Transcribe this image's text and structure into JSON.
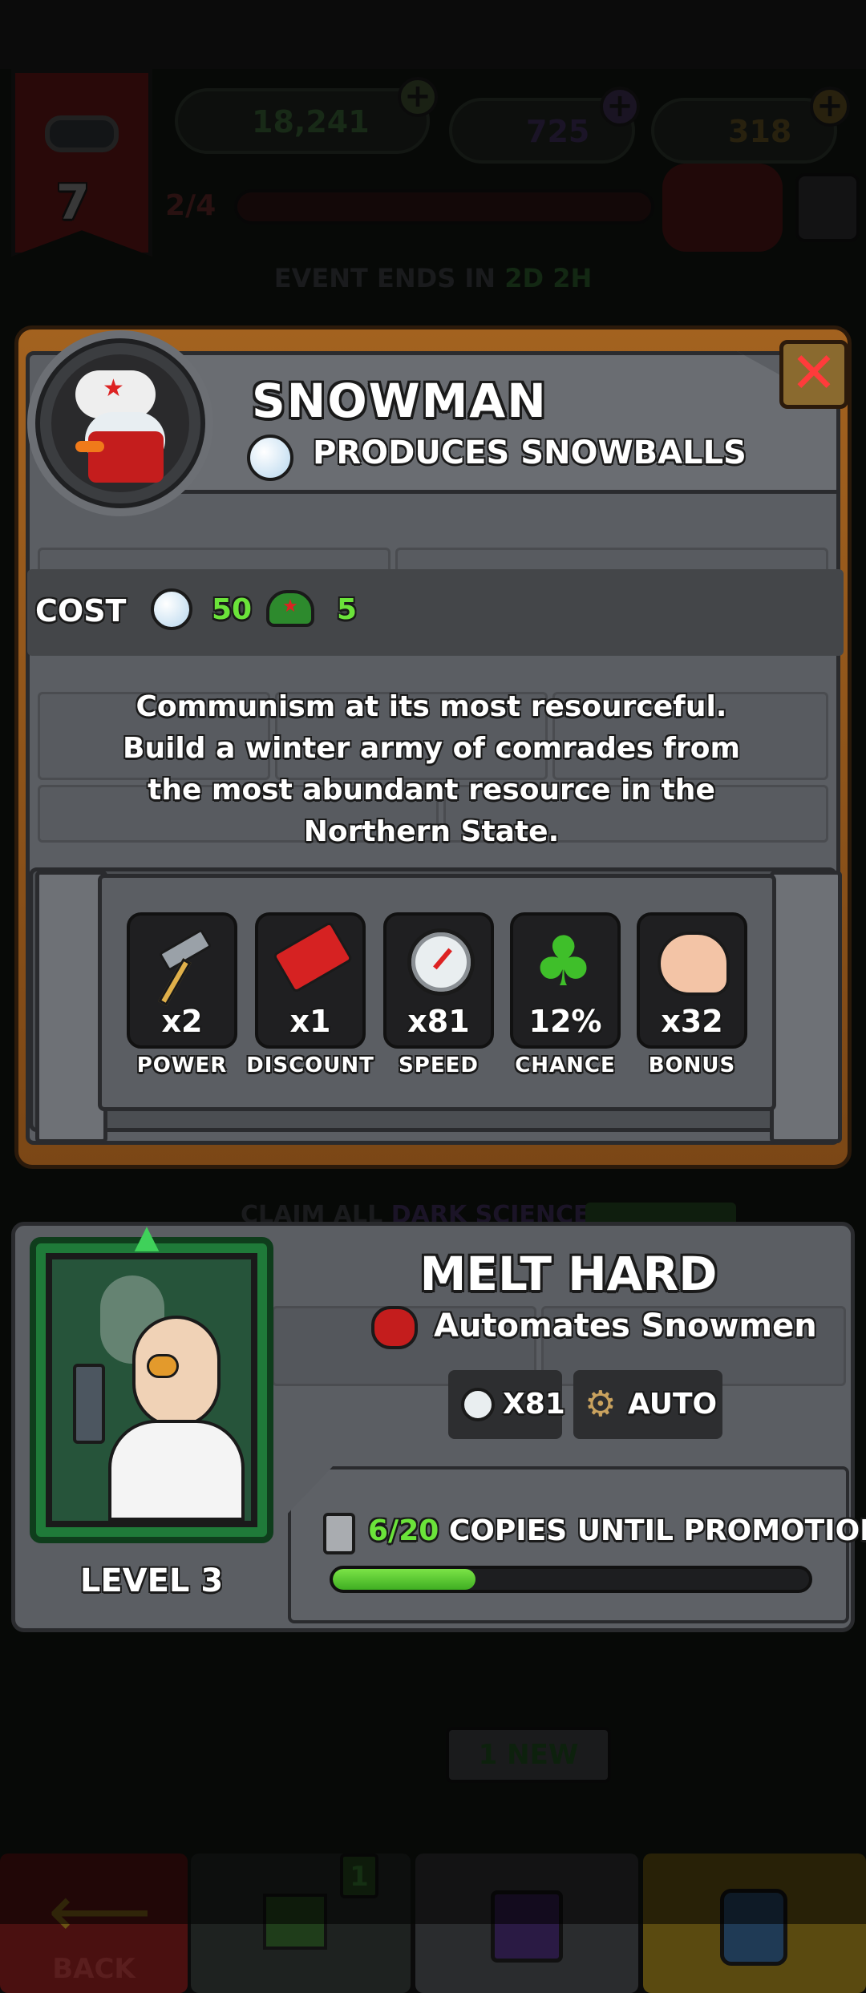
{
  "hud": {
    "level": "7",
    "rank_progress": "2/4",
    "currency_hats": "18,241",
    "currency_potions": "725",
    "currency_gold": "318",
    "event_label": "EVENT ENDS IN",
    "event_time": "2D 2H"
  },
  "bg": {
    "claim_all": "CLAIM ALL",
    "dark_science": "DARK SCIENCE",
    "new_badge": "1 NEW",
    "flag_count": "1",
    "back_label": "BACK"
  },
  "modal": {
    "title": "SNOWMAN",
    "subtitle": "PRODUCES SNOWBALLS",
    "cost_label": "COST",
    "cost_snowballs": "50",
    "cost_hats": "5",
    "description": "Communism at its most resourceful. Build a winter army of comrades from the most abundant resource in the Northern State.",
    "stats": [
      {
        "icon": "hammer-icon",
        "value": "x2",
        "label": "POWER"
      },
      {
        "icon": "price-tag-icon",
        "value": "x1",
        "label": "DISCOUNT"
      },
      {
        "icon": "speedometer-icon",
        "value": "x81",
        "label": "SPEED"
      },
      {
        "icon": "clover-icon",
        "value": "12%",
        "label": "CHANCE"
      },
      {
        "icon": "bicep-icon",
        "value": "x32",
        "label": "BONUS"
      }
    ]
  },
  "manager": {
    "name": "MELT HARD",
    "ability": "Automates Snowmen",
    "speed_chip": "X81",
    "auto_chip": "AUTO",
    "level": "LEVEL 3",
    "copies": "6/20",
    "copies_label": "COPIES UNTIL PROMOTION",
    "copies_progress": 0.3
  },
  "colors": {
    "accent_green": "#6be33a",
    "close_red": "#ff3b3b",
    "wood": "#a3621f",
    "metal": "#5b5e63"
  }
}
